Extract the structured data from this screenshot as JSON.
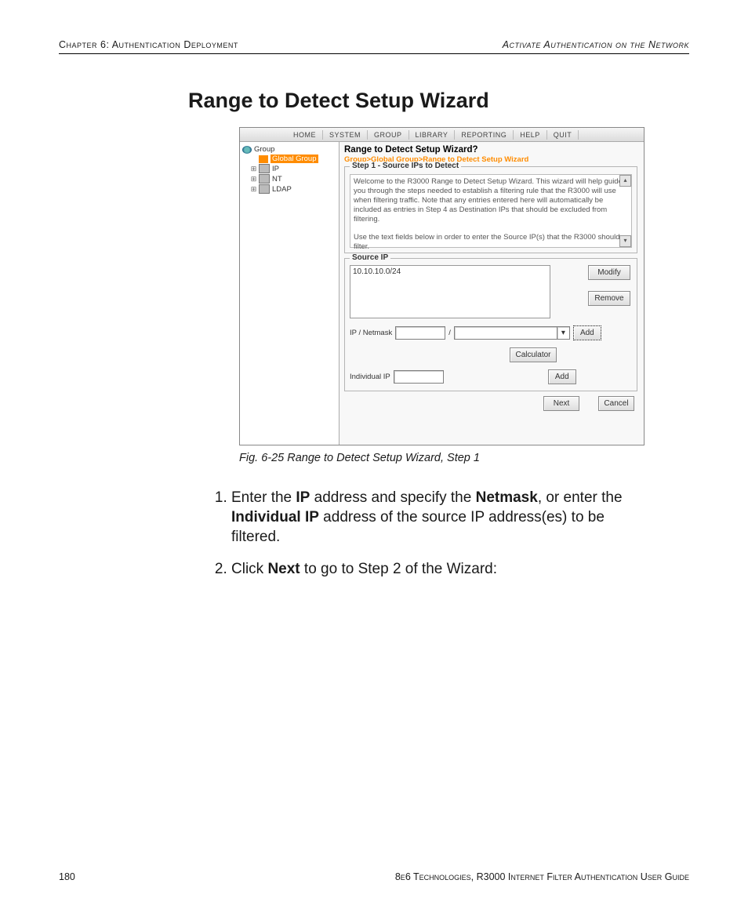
{
  "header": {
    "left": "Chapter 6: Authentication Deployment",
    "right": "Activate Authentication on the Network"
  },
  "heading": "Range to Detect Setup Wizard",
  "app": {
    "menu": {
      "home": "HOME",
      "system": "SYSTEM",
      "group": "GROUP",
      "library": "LIBRARY",
      "reporting": "REPORTING",
      "help": "HELP",
      "quit": "QUIT"
    },
    "tree": {
      "root": "Group",
      "global": "Global Group",
      "ip": "IP",
      "nt": "NT",
      "ldap": "LDAP"
    },
    "panel": {
      "title": "Range to Detect Setup Wizard",
      "breadcrumb": "Group>Global Group>Range to Detect Setup Wizard",
      "step_title": "Step 1 - Source IPs to Detect",
      "intro_p1": "Welcome to the R3000 Range to Detect Setup Wizard. This wizard will help guide you through the steps needed to establish a filtering rule that the R3000 will use when filtering traffic. Note that any entries entered here will automatically be included as entries in Step 4 as Destination IPs that should be excluded from filtering.",
      "intro_p2": "Use the text fields below in order to enter the Source IP(s) that the R3000 should filter.",
      "source_ip_title": "Source IP",
      "list_value": "10.10.10.0/24",
      "modify": "Modify",
      "remove": "Remove",
      "ip_netmask_label": "IP / Netmask",
      "add": "Add",
      "calculator": "Calculator",
      "individual_ip_label": "Individual IP",
      "next": "Next",
      "cancel": "Cancel"
    }
  },
  "caption": "Fig. 6-25  Range to Detect Setup Wizard, Step 1",
  "instructions": {
    "item1_pre": "Enter the ",
    "item1_b1": "IP",
    "item1_mid1": " address and specify the ",
    "item1_b2": "Netmask",
    "item1_mid2": ", or enter the ",
    "item1_b3": "Individual IP",
    "item1_post": " address of the source IP address(es) to be filtered.",
    "item2_pre": "Click ",
    "item2_b": "Next",
    "item2_post": " to go to Step 2 of the Wizard:"
  },
  "footer": {
    "page": "180",
    "line": "8e6 Technologies, R3000 Internet Filter Authentication User Guide"
  }
}
